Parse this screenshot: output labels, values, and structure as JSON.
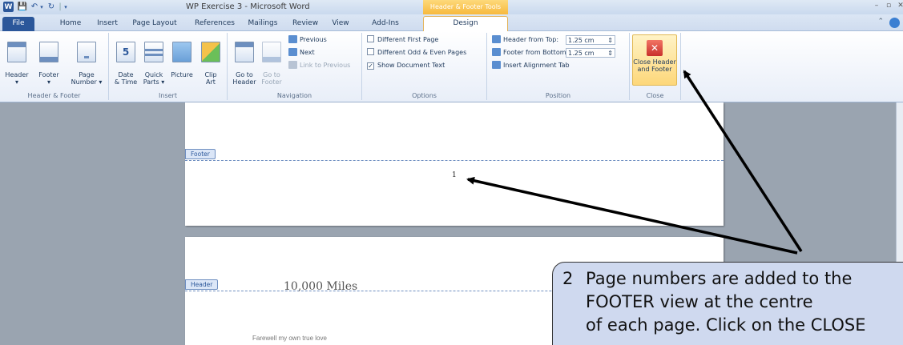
{
  "titlebar": {
    "app_icon": "W",
    "window_title": "WP Exercise 3  -  Microsoft Word",
    "context_tab_header": "Header & Footer Tools",
    "window_buttons": [
      "–",
      "▫",
      "✕"
    ]
  },
  "tabs": [
    {
      "label": "File"
    },
    {
      "label": "Home"
    },
    {
      "label": "Insert"
    },
    {
      "label": "Page Layout"
    },
    {
      "label": "References"
    },
    {
      "label": "Mailings"
    },
    {
      "label": "Review"
    },
    {
      "label": "View"
    },
    {
      "label": "Add-Ins"
    },
    {
      "label": "Design"
    }
  ],
  "ribbon": {
    "header_footer": {
      "label": "Header & Footer",
      "header": "Header\n▾",
      "footer": "Footer\n▾",
      "page_number": "Page\nNumber ▾"
    },
    "insert": {
      "label": "Insert",
      "date_time": "Date\n& Time",
      "quick_parts": "Quick\nParts ▾",
      "picture": "Picture",
      "clip_art": "Clip\nArt"
    },
    "navigation": {
      "label": "Navigation",
      "go_to_header": "Go to\nHeader",
      "go_to_footer": "Go to\nFooter",
      "previous": "Previous",
      "next": "Next",
      "link_to_previous": "Link to Previous"
    },
    "options": {
      "label": "Options",
      "different_first_page": "Different First Page",
      "different_odd_even": "Different Odd & Even Pages",
      "show_document_text": "Show Document Text",
      "show_document_text_checked": "✓"
    },
    "position": {
      "label": "Position",
      "header_from_top": "Header from Top:",
      "header_from_top_value": "1.25 cm",
      "footer_from_bottom": "Footer from Bottom:",
      "footer_from_bottom_value": "1.25 cm",
      "insert_alignment_tab": "Insert Alignment Tab"
    },
    "close": {
      "label": "Close",
      "close_button": "Close Header\nand Footer"
    }
  },
  "document": {
    "footer_tag": "Footer",
    "page_number": "1",
    "header_tag": "Header",
    "title": "10,000 Miles",
    "first_line": "Farewell my own true love"
  },
  "callout": {
    "step": "2",
    "line1": "Page numbers are added to the",
    "line2": "FOOTER view at the centre",
    "line3": "of each page. Click on the CLOSE"
  },
  "colors": {
    "accent": "#2b579a",
    "context_tab": "#f7b93e",
    "callout_bg": "#cfd9ef",
    "doc_background": "#9aa4b0"
  }
}
